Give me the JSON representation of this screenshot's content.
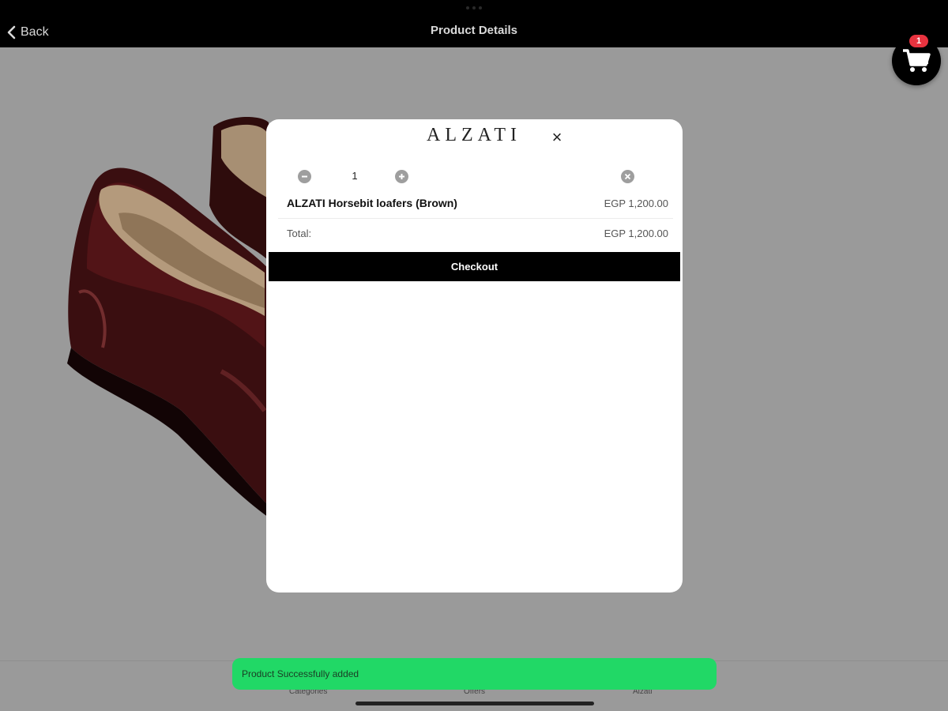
{
  "nav": {
    "back_label": "Back",
    "title": "Product Details"
  },
  "cart": {
    "badge_count": "1",
    "icon": "shopping-cart-icon"
  },
  "modal": {
    "brand": "ALZATI",
    "close_label": "×",
    "quantity": "1",
    "item_name": "ALZATI Horsebit loafers (Brown)",
    "item_price": "EGP 1,200.00",
    "total_label": "Total:",
    "total_value": "EGP 1,200.00",
    "checkout_label": "Checkout"
  },
  "tabs": [
    {
      "label": "Categories"
    },
    {
      "label": "Offers"
    },
    {
      "label": "Alzati"
    }
  ],
  "toast": {
    "message": "Product Successfully added"
  },
  "colors": {
    "overlay_bg": "#9a9a9a",
    "toast_bg": "#21d866",
    "badge": "#e8333f",
    "checkout_bg": "#000000"
  }
}
